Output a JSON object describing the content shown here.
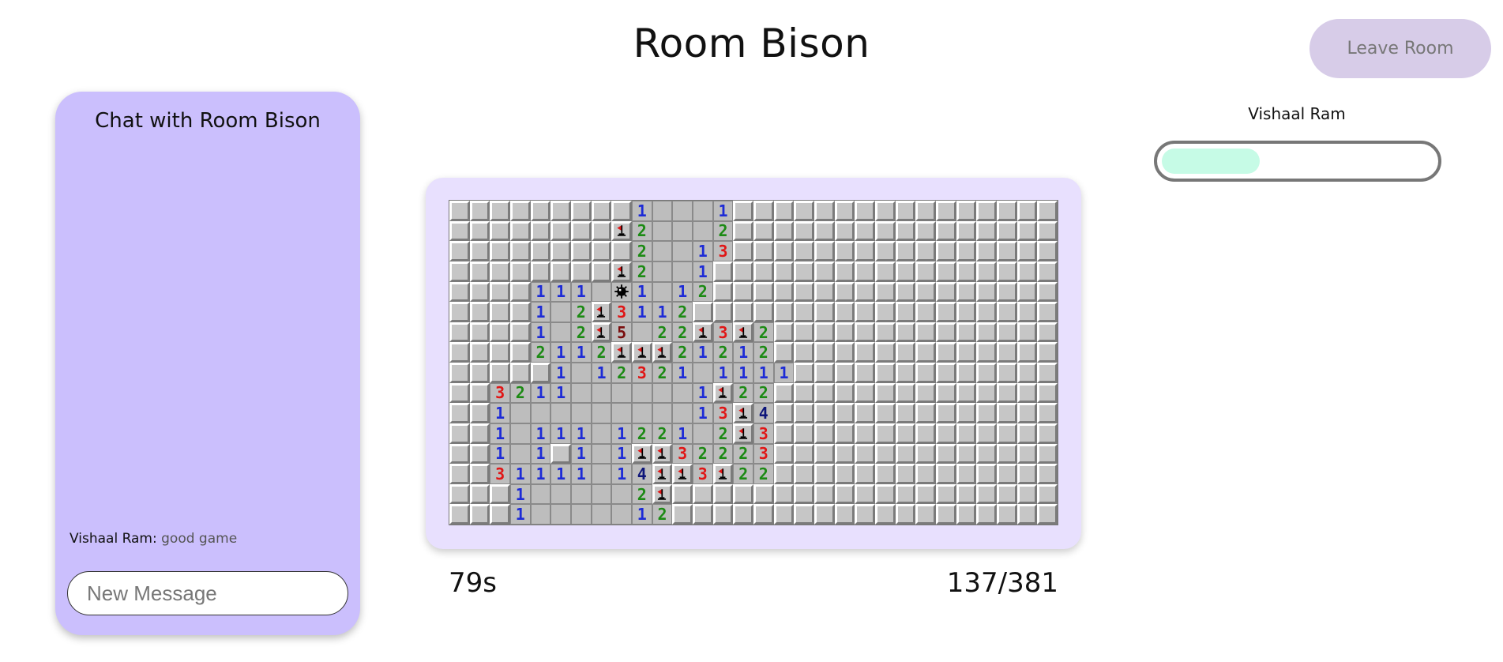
{
  "room": {
    "title": "Room Bison"
  },
  "header": {
    "leave_label": "Leave Room"
  },
  "chat": {
    "title": "Chat with Room Bison",
    "messages": [
      {
        "author": "Vishaal Ram",
        "separator": ": ",
        "text": "good game"
      }
    ],
    "input_placeholder": "New Message"
  },
  "player": {
    "name": "Vishaal Ram",
    "progress_fraction": 0.36,
    "progress_color": "#c6fbe6"
  },
  "game": {
    "timer": "79s",
    "revealed_count": "137/381",
    "board": {
      "rows": 16,
      "cols": 30,
      "legend": {
        "#": "hidden",
        ".": "empty",
        "F": "flag",
        "*": "mine",
        "1-8": "number"
      },
      "grid": [
        "#########1...1################",
        "########F2...2################",
        "#########2..13################",
        "########F2..1#################",
        "####111.*1.12#################",
        "####1.2F3112##################",
        "####1.2F5.22F3F2##############",
        "####2112FFF21212##############",
        "#####1.12321.1111#############",
        "##3211......1F22##############",
        "##1.........13F4##############",
        "##1.111.1221.2F3##############",
        "##1.1#1.1FF32223##############",
        "##31111.14FF3F22##############",
        "###1.....2F###################",
        "###1.....12###################"
      ]
    }
  },
  "colors": {
    "accent_chat_panel": "#cbbffd",
    "board_panel": "#e8e0fe",
    "leave_button": "#d7cce8",
    "num1": "#1d2bd6",
    "num2": "#1c8a14",
    "num3": "#e01616",
    "num4": "#0d157a",
    "num5": "#7a0e0e"
  },
  "icons": {
    "flag": "flag-icon",
    "mine": "mine-icon"
  }
}
